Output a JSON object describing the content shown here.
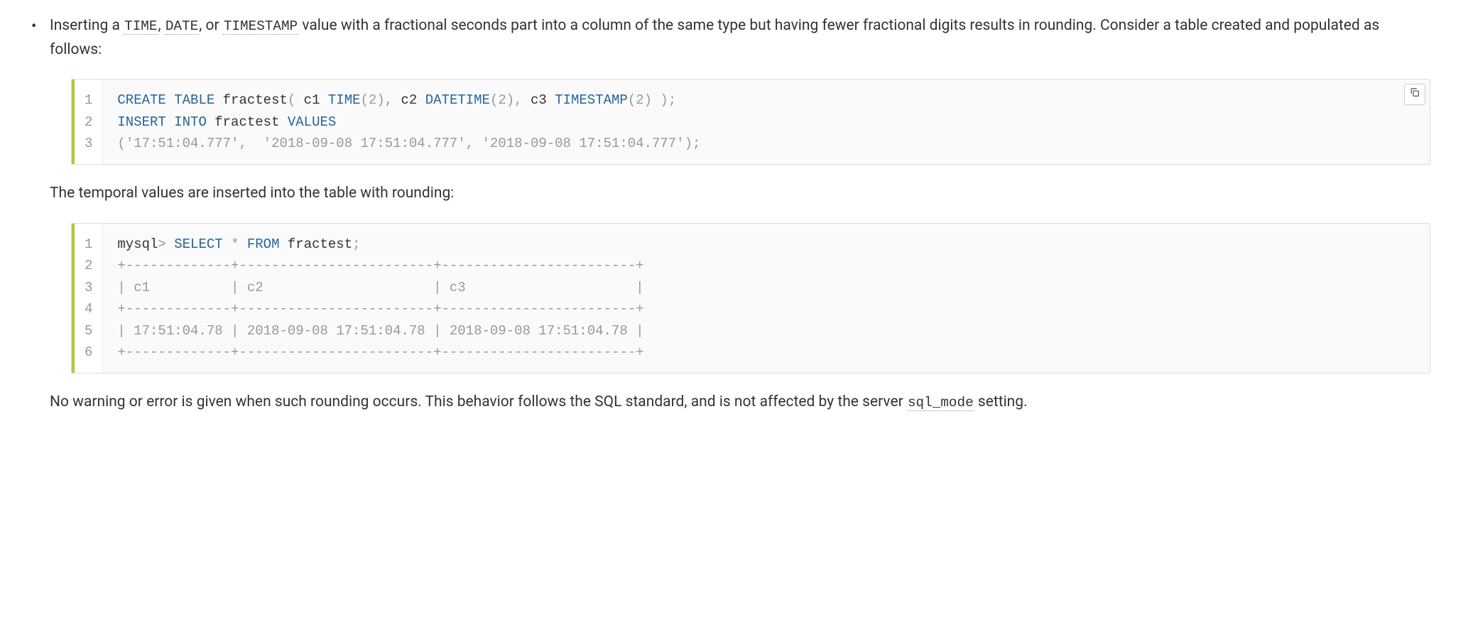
{
  "bullet": {
    "prefix": "Inserting a ",
    "code1": "TIME",
    "mid1": ", ",
    "code2": "DATE",
    "mid2": ", or ",
    "code3": "TIMESTAMP",
    "suffix": " value with a fractional seconds part into a column of the same type but having fewer fractional digits results in rounding. Consider a table created and populated as follows:"
  },
  "code1": {
    "gutter": [
      "1",
      "2",
      "3"
    ],
    "l1": {
      "t1": "CREATE",
      "t2": "TABLE",
      "t3": "fractest",
      "p1": "(",
      "t4": " c1 ",
      "t5": "TIME",
      "p2": "(",
      "n1": "2",
      "p3": "),",
      "t6": " c2 ",
      "t7": "DATETIME",
      "p4": "(",
      "n2": "2",
      "p5": "),",
      "t8": " c3 ",
      "t9": "TIMESTAMP",
      "p6": "(",
      "n3": "2",
      "p7": ") );"
    },
    "l2": {
      "t1": "INSERT",
      "t2": "INTO",
      "t3": "fractest",
      "t4": "VALUES"
    },
    "l3": {
      "p1": "(",
      "s1": "'17:51:04.777'",
      "c1": ",  ",
      "s2": "'2018-09-08 17:51:04.777'",
      "c2": ", ",
      "s3": "'2018-09-08 17:51:04.777'",
      "p2": ");"
    }
  },
  "para2": "The temporal values are inserted into the table with rounding:",
  "code2": {
    "gutter": [
      "1",
      "2",
      "3",
      "4",
      "5",
      "6"
    ],
    "l1": {
      "t1": "mysql",
      "op": ">",
      "t2": "SELECT",
      "star": "*",
      "t3": "FROM",
      "t4": "fractest",
      "p1": ";"
    },
    "l2": "+-------------+------------------------+------------------------+",
    "l3": "| c1          | c2                     | c3                     |",
    "l4": "+-------------+------------------------+------------------------+",
    "l5": "| 17:51:04.78 | 2018-09-08 17:51:04.78 | 2018-09-08 17:51:04.78 |",
    "l6": "+-------------+------------------------+------------------------+"
  },
  "para3": {
    "prefix": "No warning or error is given when such rounding occurs. This behavior follows the SQL standard, and is not affected by the server ",
    "code": "sql_mode",
    "suffix": " setting."
  }
}
